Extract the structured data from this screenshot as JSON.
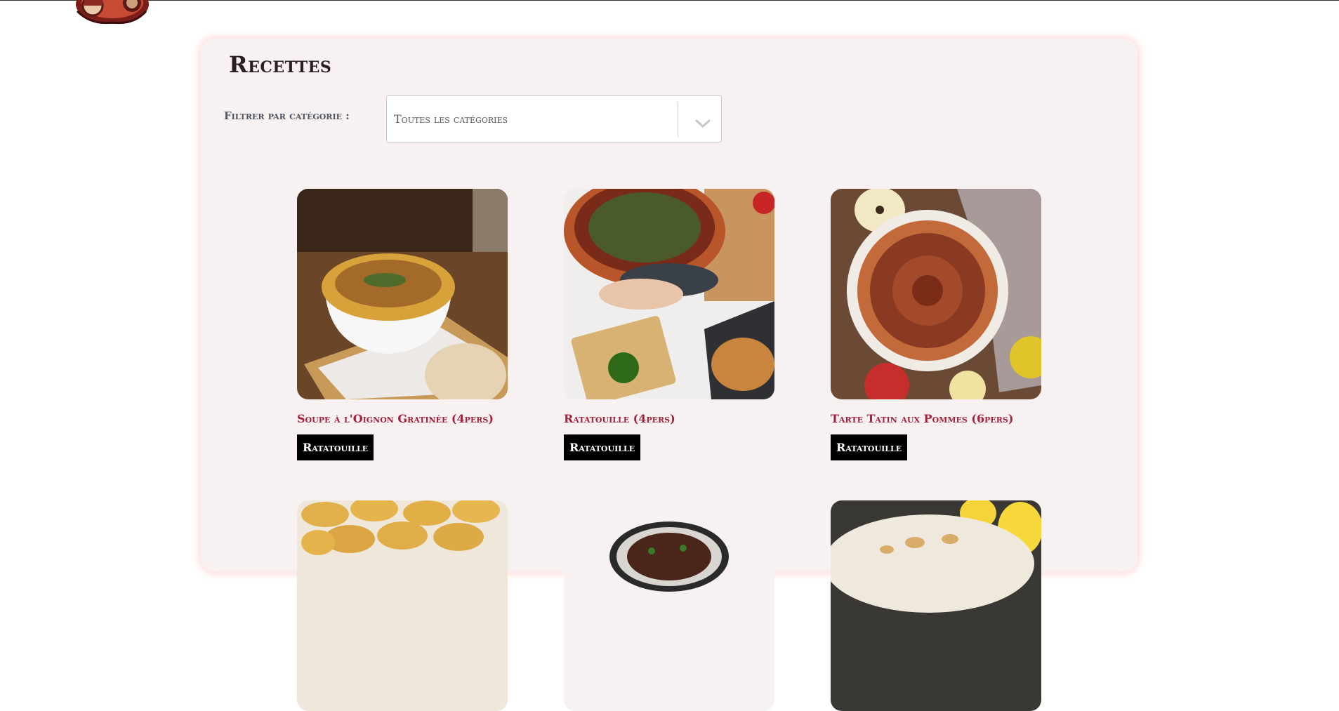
{
  "header": {
    "logo_icon": "restaurant-logo-icon"
  },
  "main": {
    "title": "Recettes",
    "filter": {
      "label": "Filtrer par catégorie :",
      "selected": "Toutes les catégories"
    },
    "recipes": [
      {
        "title": "Soupe à l'Oignon Gratinée (4pers)",
        "tag": "Ratatouille",
        "image": "onion-soup-photo"
      },
      {
        "title": "Ratatouille (4pers)",
        "tag": "Ratatouille",
        "image": "ratatouille-photo"
      },
      {
        "title": "Tarte Tatin aux Pommes (6pers)",
        "tag": "Ratatouille",
        "image": "tarte-tatin-photo"
      },
      {
        "image": "madeleines-photo"
      },
      {
        "image": "beef-stew-photo"
      },
      {
        "image": "lemon-tart-photo"
      }
    ]
  },
  "colors": {
    "panel_bg": "#f8f1f2",
    "title_text": "#2b1d24",
    "recipe_title": "#a3213a",
    "tag_bg": "#000000",
    "tag_text": "#ffffff"
  }
}
